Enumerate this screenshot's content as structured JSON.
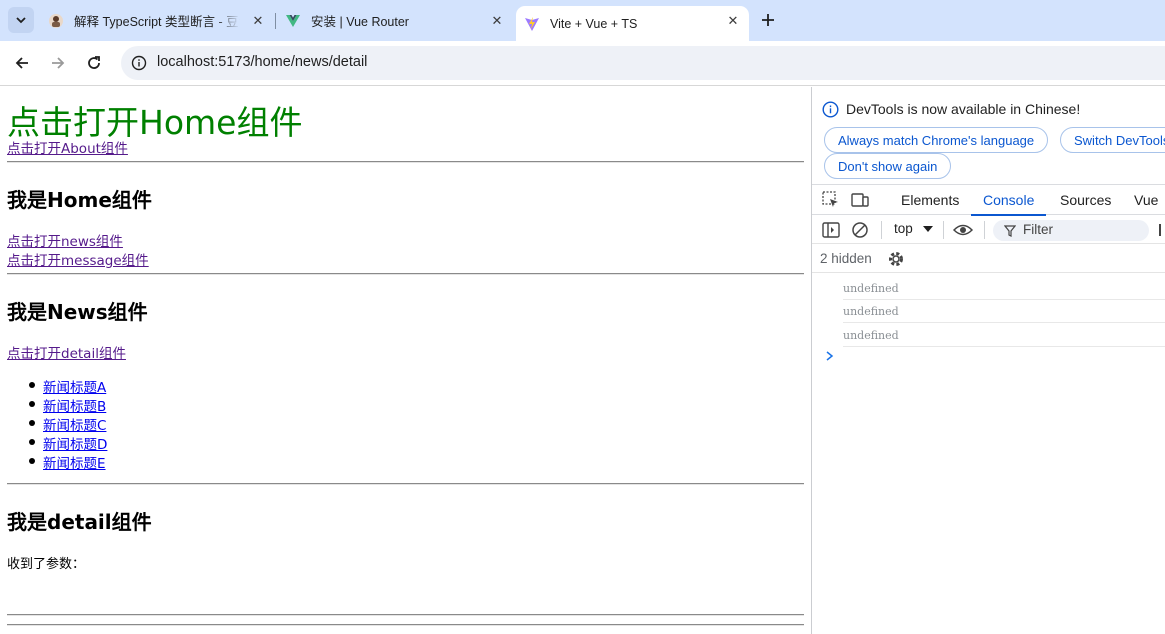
{
  "browser": {
    "tabs": [
      {
        "title": "解释 TypeScript 类型断言 - 豆包",
        "icon": "doubao-avatar-icon",
        "active": false
      },
      {
        "title": "安装 | Vue Router",
        "icon": "vue-logo-icon",
        "active": false
      },
      {
        "title": "Vite + Vue + TS",
        "icon": "vite-logo-icon",
        "active": true
      }
    ],
    "url": "localhost:5173/home/news/detail"
  },
  "page": {
    "home_link": "点击打开Home组件",
    "about_link": "点击打开About组件",
    "home_heading": "我是Home组件",
    "news_link": "点击打开news组件",
    "message_link": "点击打开message组件",
    "news_heading": "我是News组件",
    "detail_link": "点击打开detail组件",
    "news_items": [
      "新闻标题A",
      "新闻标题B",
      "新闻标题C",
      "新闻标题D",
      "新闻标题E"
    ],
    "detail_heading": "我是detail组件",
    "param_label": "收到了参数："
  },
  "devtools": {
    "notice": "DevTools is now available in Chinese!",
    "btn_match": "Always match Chrome's language",
    "btn_switch": "Switch DevTools",
    "btn_dont_show": "Don't show again",
    "tabs": [
      "Elements",
      "Console",
      "Sources",
      "Vue"
    ],
    "active_tab": "Console",
    "context": "top",
    "filter_placeholder": "Filter",
    "hidden_count": "2 hidden",
    "logs": [
      "undefined",
      "undefined",
      "undefined"
    ]
  },
  "colors": {
    "accent": "#0b57d0",
    "heading_green": "#008000",
    "link_visited": "#551a8b",
    "link_blue": "#0000ee"
  }
}
